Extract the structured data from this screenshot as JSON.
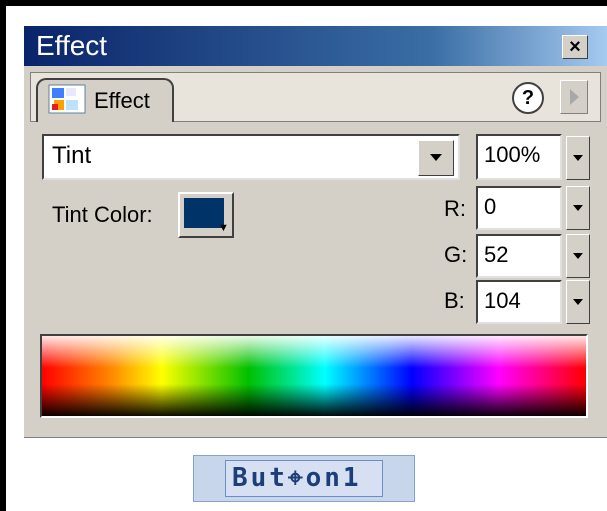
{
  "window": {
    "title": "Effect",
    "close_label": "×"
  },
  "tabs": [
    {
      "label": "Effect"
    }
  ],
  "help": {
    "label": "?"
  },
  "effect": {
    "type": "Tint",
    "amount": "100%",
    "tint_color_label": "Tint Color:",
    "tint_color": "#003468"
  },
  "rgb": {
    "r_label": "R:",
    "r_value": "0",
    "g_label": "G:",
    "g_value": "52",
    "b_label": "B:",
    "b_value": "104"
  },
  "stage": {
    "button_label": "But⌖on1"
  }
}
